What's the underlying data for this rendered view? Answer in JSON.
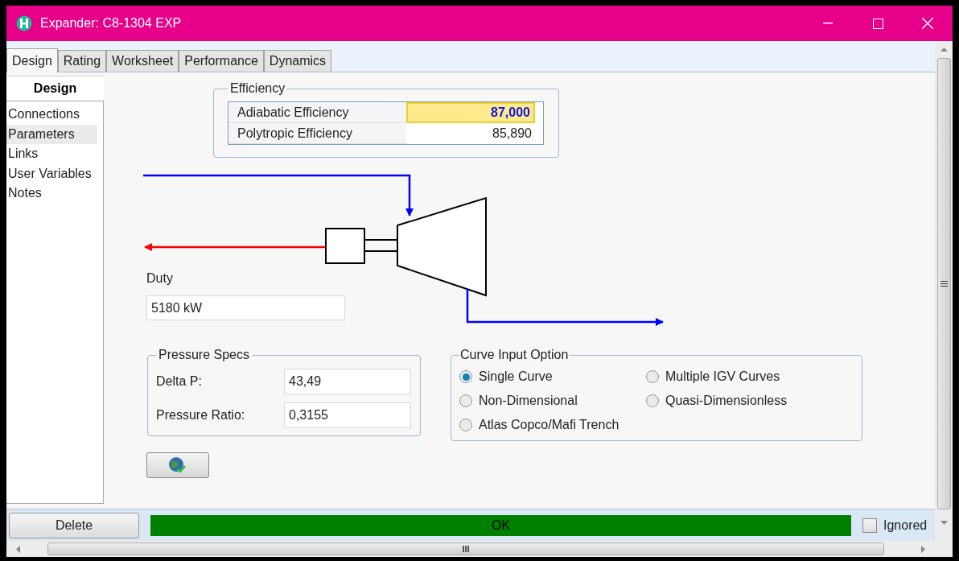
{
  "window": {
    "title": "Expander: C8-1304 EXP"
  },
  "tabs": [
    {
      "label": "Design",
      "selected": true
    },
    {
      "label": "Rating",
      "selected": false
    },
    {
      "label": "Worksheet",
      "selected": false
    },
    {
      "label": "Performance",
      "selected": false
    },
    {
      "label": "Dynamics",
      "selected": false
    }
  ],
  "sidebar": {
    "title": "Design",
    "items": [
      {
        "label": "Connections",
        "selected": false
      },
      {
        "label": "Parameters",
        "selected": true
      },
      {
        "label": "Links",
        "selected": false
      },
      {
        "label": "User Variables",
        "selected": false
      },
      {
        "label": "Notes",
        "selected": false
      }
    ]
  },
  "efficiency": {
    "title": "Efficiency",
    "rows": [
      {
        "label": "Adiabatic Efficiency",
        "value": "87,000",
        "specified": true
      },
      {
        "label": "Polytropic Efficiency",
        "value": "85,890",
        "specified": false
      }
    ]
  },
  "duty": {
    "label": "Duty",
    "value": "5180 kW"
  },
  "pressure_specs": {
    "title": "Pressure Specs",
    "fields": [
      {
        "label": "Delta P:",
        "value": "43,49"
      },
      {
        "label": "Pressure Ratio:",
        "value": "0,3155"
      }
    ]
  },
  "curve_input_option": {
    "title": "Curve Input Option",
    "options": [
      {
        "label": "Single Curve",
        "selected": true
      },
      {
        "label": "Multiple IGV Curves",
        "selected": false
      },
      {
        "label": "Non-Dimensional",
        "selected": false
      },
      {
        "label": "Quasi-Dimensionless",
        "selected": false
      },
      {
        "label": "Atlas Copco/Mafi Trench",
        "selected": false
      }
    ]
  },
  "bottom_bar": {
    "delete": "Delete",
    "status": "OK",
    "status_ok": true,
    "ignored": {
      "label": "Ignored",
      "checked": false
    }
  },
  "scrollbar_grip": "III"
}
